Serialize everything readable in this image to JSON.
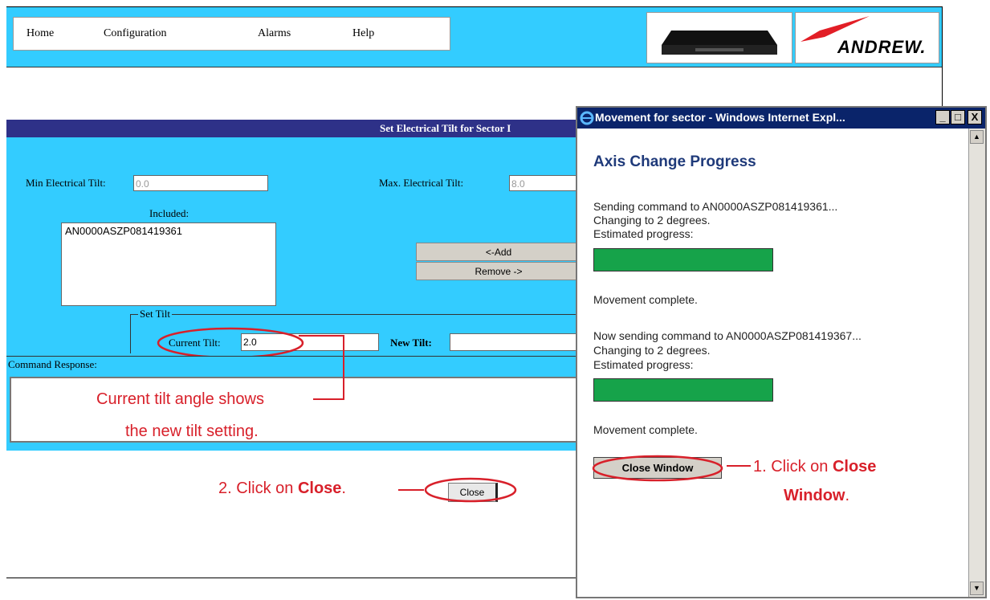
{
  "menu": {
    "home": "Home",
    "configuration": "Configuration",
    "alarms": "Alarms",
    "help": "Help"
  },
  "brand": {
    "name": "ANDREW."
  },
  "form": {
    "title": "Set Electrical Tilt for Sector I",
    "min_tilt_label": "Min Electrical Tilt:",
    "min_tilt_value": "0.0",
    "max_tilt_label": "Max. Electrical Tilt:",
    "max_tilt_value": "8.0",
    "included_label": "Included:",
    "included_items": [
      "AN0000ASZP081419361"
    ],
    "add_label": "<-Add",
    "remove_label": "Remove ->",
    "set_tilt_label": "Set Tilt",
    "current_tilt_label": "Current Tilt:",
    "current_tilt_value": "2.0",
    "new_tilt_label": "New Tilt:",
    "new_tilt_value": "",
    "command_response_label": "Command Response:",
    "close_label": "Close"
  },
  "popup": {
    "title": "Movement for sector - Windows Internet Expl...",
    "heading": "Axis Change Progress",
    "line1": "Sending command to AN0000ASZP081419361...",
    "line2": "Changing to 2 degrees.",
    "line3": "Estimated progress:",
    "progress1": 1.0,
    "line4": "Movement complete.",
    "line5": "Now sending command to AN0000ASZP081419367...",
    "line6": "Changing to 2 degrees.",
    "line7": "Estimated progress:",
    "progress2": 1.0,
    "line8": "Movement complete.",
    "close_window_label": "Close Window",
    "btn_min": "_",
    "btn_max": "□",
    "btn_close": "X"
  },
  "annotations": {
    "tilt_note_1": "Current tilt angle shows",
    "tilt_note_2": "the new tilt setting.",
    "step2_prefix": "2.  Click on ",
    "step2_bold": "Close",
    "step2_suffix": ".",
    "step1_prefix": "1.  Click on ",
    "step1_bold1": "Close",
    "step1_bold2": "Window",
    "step1_suffix": "."
  },
  "colors": {
    "sky": "#33ccff",
    "navy": "#2e3188",
    "annotation": "#d8202a",
    "progress": "#16a34a"
  }
}
